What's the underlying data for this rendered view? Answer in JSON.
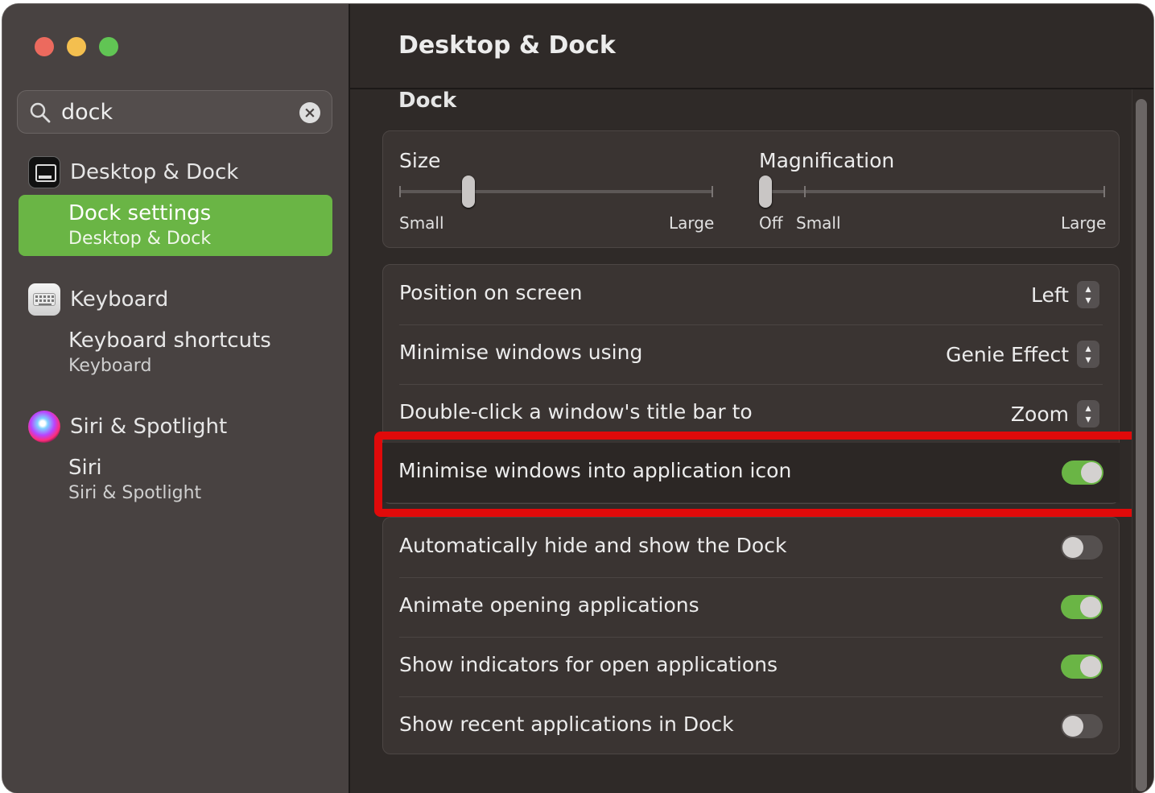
{
  "window": {
    "title": "Desktop & Dock",
    "colors": {
      "accent": "#6ab545",
      "highlight": "#e00a0a",
      "background": "#2f2a28",
      "sidebar": "#484241"
    }
  },
  "search": {
    "value": "dock",
    "icon": "search-icon",
    "clear_icon": "clear-icon"
  },
  "sidebar": {
    "groups": [
      {
        "label": "Desktop & Dock",
        "icon": "desktop-dock-icon",
        "items": [
          {
            "title": "Dock settings",
            "subtitle": "Desktop & Dock",
            "selected": true
          }
        ]
      },
      {
        "label": "Keyboard",
        "icon": "keyboard-icon",
        "items": [
          {
            "title": "Keyboard shortcuts",
            "subtitle": "Keyboard",
            "selected": false
          }
        ]
      },
      {
        "label": "Siri & Spotlight",
        "icon": "siri-icon",
        "items": [
          {
            "title": "Siri",
            "subtitle": "Siri & Spotlight",
            "selected": false
          }
        ]
      }
    ]
  },
  "main": {
    "section": "Dock",
    "size_slider": {
      "label": "Size",
      "min_label": "Small",
      "max_label": "Large",
      "value": 0.22
    },
    "magnification_slider": {
      "label": "Magnification",
      "off_label": "Off",
      "min_label": "Small",
      "max_label": "Large",
      "value": 0.0
    },
    "popups": [
      {
        "label": "Position on screen",
        "value": "Left"
      },
      {
        "label": "Minimise windows using",
        "value": "Genie Effect"
      },
      {
        "label": "Double-click a window's title bar to",
        "value": "Zoom"
      }
    ],
    "highlighted_toggle": {
      "label": "Minimise windows into application icon",
      "on": true
    },
    "toggles": [
      {
        "label": "Automatically hide and show the Dock",
        "on": false
      },
      {
        "label": "Animate opening applications",
        "on": true
      },
      {
        "label": "Show indicators for open applications",
        "on": true
      },
      {
        "label": "Show recent applications in Dock",
        "on": false
      }
    ]
  }
}
